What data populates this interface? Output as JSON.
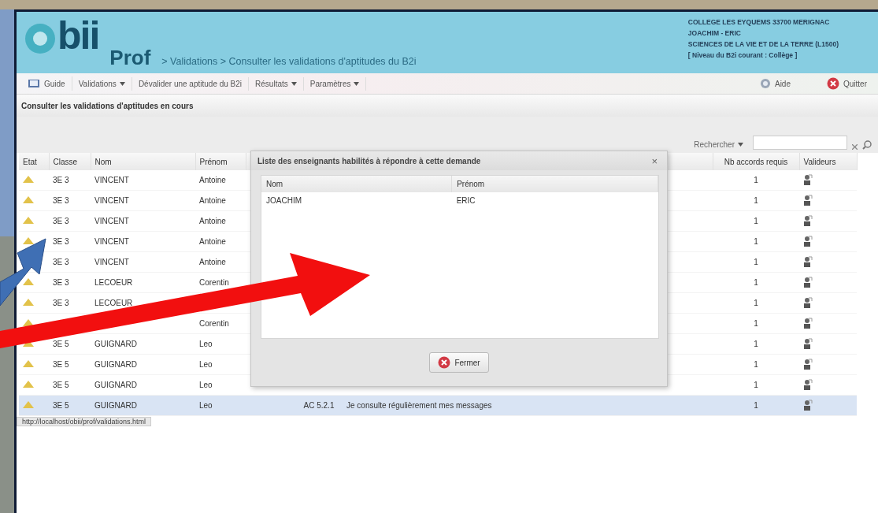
{
  "header": {
    "logo": "bii",
    "product": "Prof",
    "breadcrumb": "> Validations > Consulter les validations d'aptitudes du B2i",
    "user_info": [
      "COLLEGE LES EYQUEMS 33700 MERIGNAC",
      "JOACHIM - ERIC",
      "SCIENCES DE LA VIE ET DE LA TERRE (L1500)",
      "[ Niveau du B2i courant : Collège ]"
    ]
  },
  "toolbar": {
    "items": [
      {
        "kind": "book",
        "label": "Guide",
        "dropdown": false
      },
      {
        "kind": "plain",
        "label": "Validations",
        "dropdown": true
      },
      {
        "kind": "plain",
        "label": "Dévalider une aptitude du B2i",
        "dropdown": false
      },
      {
        "kind": "plain",
        "label": "Résultats",
        "dropdown": true
      },
      {
        "kind": "plain",
        "label": "Paramètres",
        "dropdown": true
      }
    ],
    "right": [
      {
        "kind": "help",
        "label": "Aide"
      },
      {
        "kind": "quit",
        "label": "Quitter"
      }
    ]
  },
  "section_title": "Consulter les validations d'aptitudes en cours",
  "search": {
    "label": "Rechercher"
  },
  "table": {
    "columns": [
      "Etat",
      "Classe",
      "Nom",
      "Prénom",
      "Nb accords requis",
      "Valideurs"
    ],
    "rows": [
      {
        "kind": "warning",
        "classe": "3E 3",
        "nom": "VINCENT",
        "prenom": "Antoine",
        "nb": "1",
        "selected": false
      },
      {
        "kind": "warning",
        "classe": "3E 3",
        "nom": "VINCENT",
        "prenom": "Antoine",
        "nb": "1",
        "selected": false
      },
      {
        "kind": "warning",
        "classe": "3E 3",
        "nom": "VINCENT",
        "prenom": "Antoine",
        "nb": "1",
        "selected": false
      },
      {
        "kind": "warning",
        "classe": "3E 3",
        "nom": "VINCENT",
        "prenom": "Antoine",
        "nb": "1",
        "selected": false
      },
      {
        "classe": "3E 3",
        "nom": "VINCENT",
        "prenom": "Antoine",
        "nb": "1",
        "selected": false
      },
      {
        "kind": "warning",
        "classe": "3E 3",
        "nom": "LECOEUR",
        "prenom": "Corentin",
        "nb": "1",
        "selected": false
      },
      {
        "kind": "warning",
        "classe": "3E 3",
        "nom": "LECOEUR",
        "nb": "1",
        "selected": false
      },
      {
        "kind": "warning",
        "prenom": "Corentin",
        "nb": "1",
        "selected": false
      },
      {
        "kind": "warning",
        "classe": "3E 5",
        "nom": "GUIGNARD",
        "prenom": "Leo",
        "nb": "1",
        "selected": false
      },
      {
        "kind": "warning",
        "classe": "3E 5",
        "nom": "GUIGNARD",
        "prenom": "Leo",
        "nb": "1",
        "selected": false
      },
      {
        "kind": "warning",
        "classe": "3E 5",
        "nom": "GUIGNARD",
        "prenom": "Leo",
        "nb": "1",
        "selected": false
      },
      {
        "kind": "warning",
        "classe": "3E 5",
        "nom": "GUIGNARD",
        "prenom": "Leo",
        "code": "AC 5.2.1",
        "aptitude": "Je consulte régulièrement mes messages",
        "nb": "1",
        "selected": true
      }
    ]
  },
  "dialog": {
    "title": "Liste des enseignants habilités à répondre à cette demande",
    "close": "×",
    "columns": [
      "Nom",
      "Prénom"
    ],
    "rows": [
      [
        "JOACHIM",
        "ERIC"
      ]
    ],
    "button": "Fermer"
  },
  "status_bar": "http://localhost/obii/prof/validations.html"
}
